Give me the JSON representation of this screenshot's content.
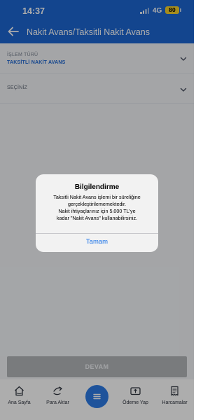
{
  "status_bar": {
    "time": "14:37",
    "network": "4G",
    "battery": "80"
  },
  "header": {
    "title": "Nakit Avans/Taksitli Nakit Avans",
    "back_icon": "arrow-left-icon"
  },
  "form": {
    "transaction_type": {
      "label": "İŞLEM TÜRÜ",
      "value": "TAKSİTLİ NAKİT AVANS"
    },
    "select": {
      "label": "SEÇİNİZ"
    }
  },
  "dialog": {
    "title": "Bilgilendirme",
    "message_lines": [
      "Taksitli Nakit Avans işlemi bir süreliğine",
      "gerçekleştirilememektedir.",
      "Nakit ihtiyaçlarınız için 5.000 TL'ye",
      "kadar \"Nakit Avans\" kullanabilirsiniz."
    ],
    "button": "Tamam"
  },
  "footer": {
    "continue_button": "DEVAM"
  },
  "tab_bar": {
    "items": [
      {
        "label": "Ana Sayfa",
        "icon": "home-icon"
      },
      {
        "label": "Para Aktar",
        "icon": "transfer-icon"
      },
      {
        "label": "",
        "icon": "menu-icon"
      },
      {
        "label": "Ödeme Yap",
        "icon": "payment-icon"
      },
      {
        "label": "Harcamalar",
        "icon": "receipt-icon"
      }
    ]
  },
  "colors": {
    "brand": "#1d66d1",
    "accent": "#2d7be5",
    "battery": "#f2cf2c",
    "disabled_button": "#b3b5b8"
  }
}
